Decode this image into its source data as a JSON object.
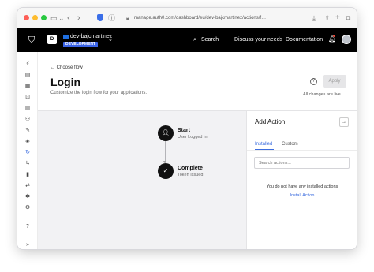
{
  "browser": {
    "url": "manage.auth0.com/dashboard/eu/dev-bajcmartinez/actions/f…",
    "traffic_lights": [
      "#fd5f57",
      "#febc2e",
      "#28c840"
    ]
  },
  "header": {
    "tenant_initial": "D",
    "tenant_name": "dev-bajcmartinez",
    "tenant_env": "DEVELOPMENT",
    "nav": {
      "search": "Search",
      "discuss": "Discuss your needs",
      "docs": "Documentation"
    }
  },
  "page": {
    "back_label": "Choose flow",
    "title": "Login",
    "subtitle": "Customize the login flow for your applications.",
    "apply_label": "Apply",
    "saved_status": "All changes are live"
  },
  "flow": {
    "start": {
      "title": "Start",
      "subtitle": "User Logged In"
    },
    "complete": {
      "title": "Complete",
      "subtitle": "Token Issued"
    }
  },
  "panel": {
    "title": "Add Action",
    "tabs": [
      {
        "label": "Installed",
        "active": true
      },
      {
        "label": "Custom",
        "active": false
      }
    ],
    "search_placeholder": "Search actions...",
    "empty_message": "You do not have any installed actions",
    "install_link": "Install Action"
  },
  "sidebar_icons": [
    "bolt-icon",
    "dashboard-icon",
    "applications-icon",
    "authentication-icon",
    "organizations-icon",
    "user-management-icon",
    "branding-icon",
    "security-icon",
    "actions-icon",
    "auth-pipeline-icon",
    "monitoring-icon",
    "marketplace-icon",
    "extensions-icon",
    "settings-icon",
    "help-icon",
    "collapse-icon"
  ]
}
